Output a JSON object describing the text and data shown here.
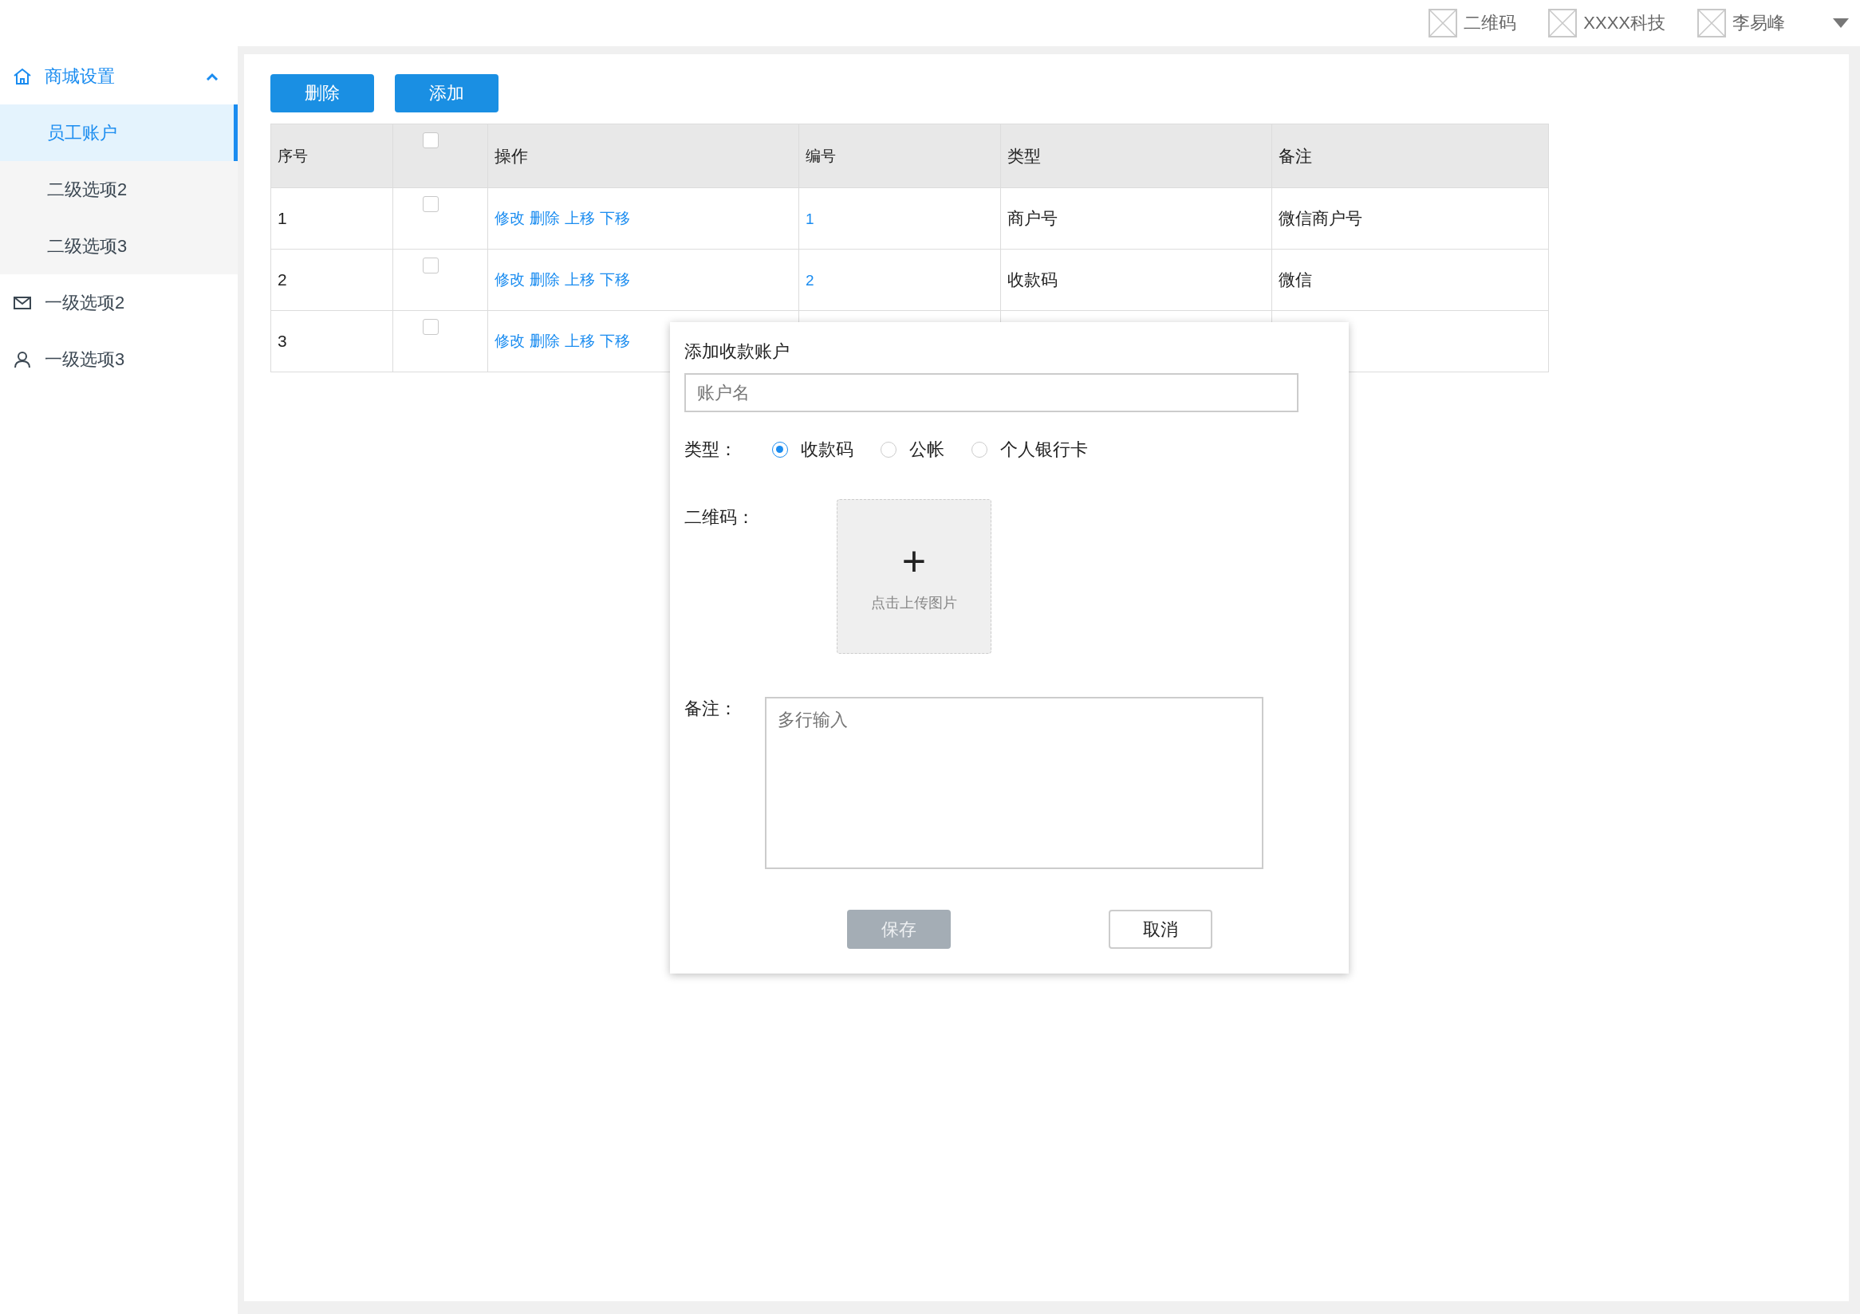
{
  "top_bar": {
    "items": [
      {
        "label": "二维码"
      },
      {
        "label": "XXXX科技"
      },
      {
        "label": "李易峰"
      }
    ]
  },
  "sidebar": {
    "items": [
      {
        "label": "商城设置",
        "kind": "home",
        "expanded": true,
        "children": [
          {
            "label": "员工账户",
            "selected": true
          },
          {
            "label": "二级选项2",
            "selected": false
          },
          {
            "label": "二级选项3",
            "selected": false
          }
        ]
      },
      {
        "label": "一级选项2",
        "kind": "mail",
        "expanded": false
      },
      {
        "label": "一级选项3",
        "kind": "user",
        "expanded": false
      }
    ]
  },
  "toolbar": {
    "buttons": [
      "删除",
      "添加"
    ]
  },
  "table": {
    "columns": [
      "序号",
      "操作",
      "编号",
      "类型",
      "备注"
    ],
    "header_checked": false,
    "rows": [
      {
        "index": "1",
        "checked": false,
        "actions": [
          "修改",
          "删除",
          "上移",
          "下移"
        ],
        "number": "1",
        "type": "商户号",
        "note": "微信商户号"
      },
      {
        "index": "2",
        "checked": false,
        "actions": [
          "修改",
          "删除",
          "上移",
          "下移"
        ],
        "number": "2",
        "type": "收款码",
        "note": "微信"
      },
      {
        "index": "3",
        "checked": false,
        "actions": [
          "修改",
          "删除",
          "上移",
          "下移"
        ]
      }
    ]
  },
  "dialog": {
    "title": "添加收款账户",
    "name_field": {
      "placeholder": "账户名"
    },
    "type_label": "类型：",
    "type_options": [
      {
        "label": "收款码",
        "selected": true
      },
      {
        "label": "公帐",
        "selected": false
      },
      {
        "label": "个人银行卡",
        "selected": false
      }
    ],
    "qr_label": "二维码：",
    "upload": {
      "icon_text": "+",
      "hint": "点击上传图片"
    },
    "note_label": "备注：",
    "note_field": {
      "placeholder": "多行输入"
    },
    "buttons": [
      {
        "label": "保存",
        "kind": "primary",
        "disabled": true
      },
      {
        "label": "取消",
        "kind": "secondary",
        "disabled": false
      }
    ]
  }
}
